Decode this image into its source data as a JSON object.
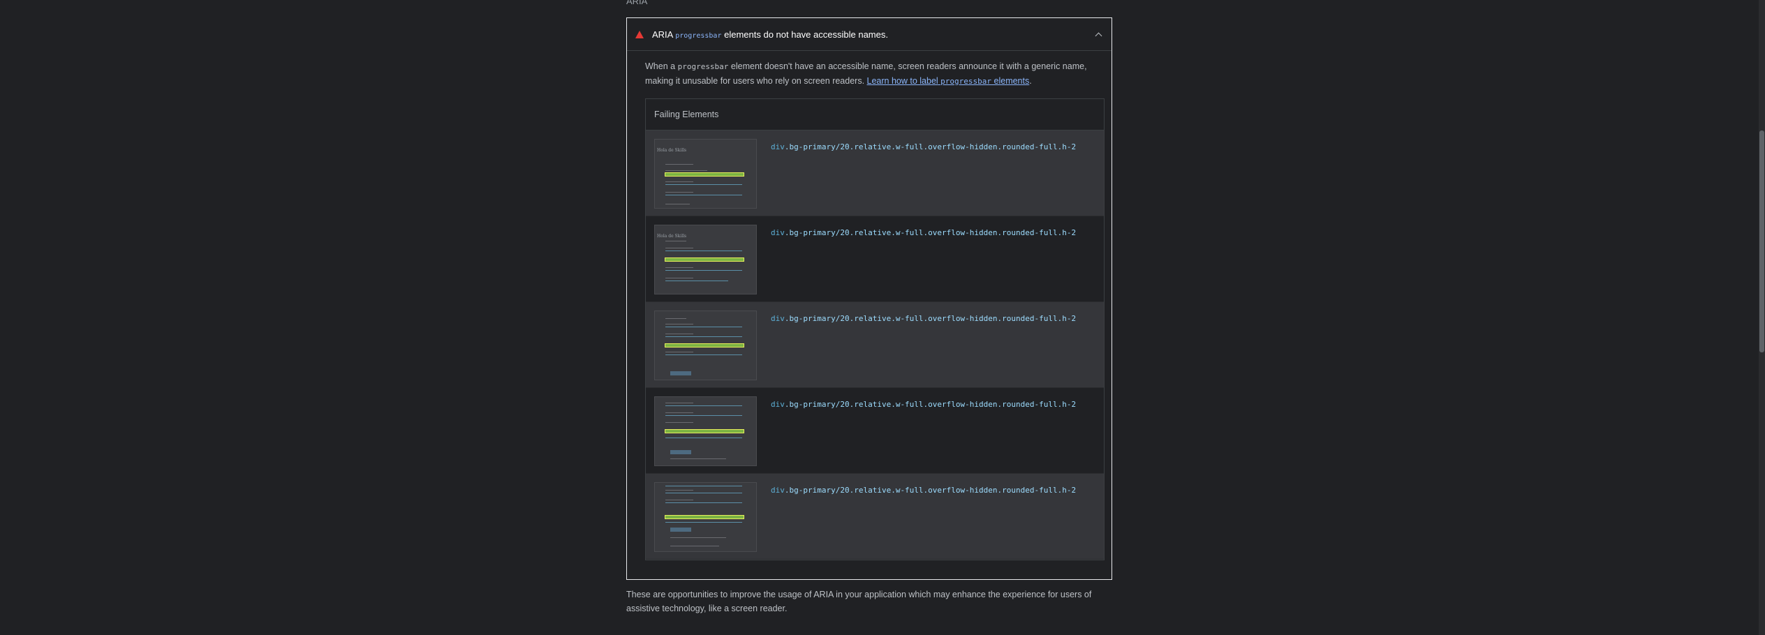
{
  "section": {
    "heading": "ARIA"
  },
  "audit": {
    "title_prefix": "ARIA",
    "title_code": "progressbar",
    "title_suffix": "elements do not have accessible names.",
    "desc_part1": "When a",
    "desc_code": "progressbar",
    "desc_part2": "element doesn't have an accessible name, screen readers announce it with a generic name, making it unusable for users who rely on screen readers.",
    "learn_prefix": "Learn how to label",
    "learn_code": "progressbar",
    "learn_suffix": "elements",
    "desc_end": "."
  },
  "failing": {
    "header": "Failing Elements",
    "rows": [
      {
        "tag": "div",
        "classes": ".bg-primary/20.relative.w-full.overflow-hidden.rounded-full.h-2"
      },
      {
        "tag": "div",
        "classes": ".bg-primary/20.relative.w-full.overflow-hidden.rounded-full.h-2"
      },
      {
        "tag": "div",
        "classes": ".bg-primary/20.relative.w-full.overflow-hidden.rounded-full.h-2"
      },
      {
        "tag": "div",
        "classes": ".bg-primary/20.relative.w-full.overflow-hidden.rounded-full.h-2"
      },
      {
        "tag": "div",
        "classes": ".bg-primary/20.relative.w-full.overflow-hidden.rounded-full.h-2"
      }
    ]
  },
  "footer": {
    "text": "These are opportunities to improve the usage of ARIA in your application which may enhance the experience for users of assistive technology, like a screen reader."
  },
  "thumb_title": "Hola de Skills",
  "colors": {
    "background": "#202124",
    "warning": "#e53935",
    "link": "#8ab4f8",
    "selector": "#9cdcfe",
    "highlight": "#e6ee5c"
  }
}
